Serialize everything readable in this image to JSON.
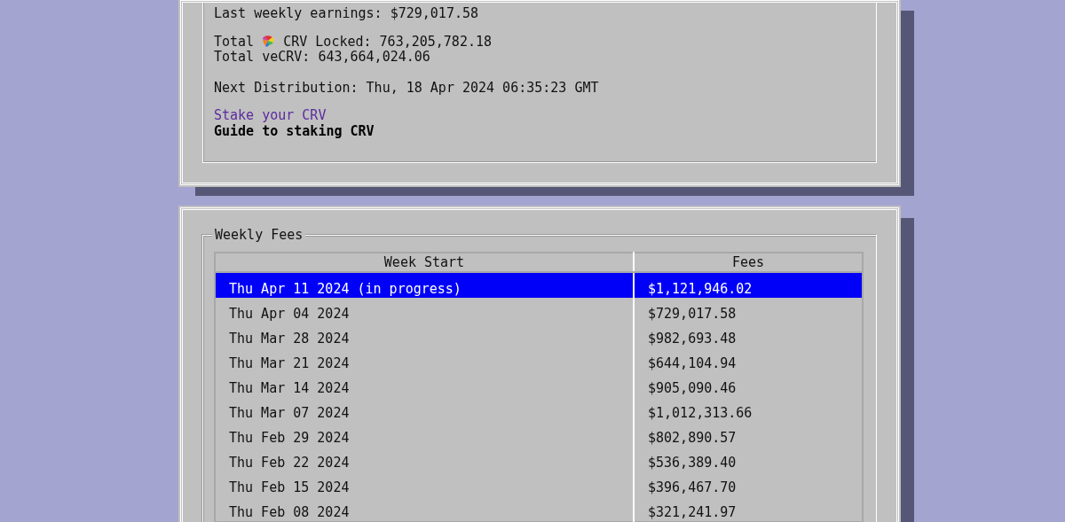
{
  "summary": {
    "lines_top": [
      "Last weekly earnings: $729,017.58"
    ],
    "crv_locked": {
      "before_icon": "Total",
      "after_icon": "CRV Locked: 763,205,782.18"
    },
    "lines_mid": [
      "Total veCRV: 643,664,024.06"
    ],
    "next_distribution": "Next Distribution: Thu, 18 Apr 2024 06:35:23 GMT",
    "links": [
      {
        "label": "Stake your CRV",
        "visited": true
      },
      {
        "label": "Guide to staking CRV",
        "visited": false
      }
    ]
  },
  "weekly_fees": {
    "title": "Weekly Fees",
    "columns": [
      "Week Start",
      "Fees"
    ],
    "rows": [
      {
        "week_start": "Thu Apr 11 2024 (in progress)",
        "fees": "$1,121,946.02",
        "selected": true
      },
      {
        "week_start": "Thu Apr 04 2024",
        "fees": "$729,017.58",
        "selected": false
      },
      {
        "week_start": "Thu Mar 28 2024",
        "fees": "$982,693.48",
        "selected": false
      },
      {
        "week_start": "Thu Mar 21 2024",
        "fees": "$644,104.94",
        "selected": false
      },
      {
        "week_start": "Thu Mar 14 2024",
        "fees": "$905,090.46",
        "selected": false
      },
      {
        "week_start": "Thu Mar 07 2024",
        "fees": "$1,012,313.66",
        "selected": false
      },
      {
        "week_start": "Thu Feb 29 2024",
        "fees": "$802,890.57",
        "selected": false
      },
      {
        "week_start": "Thu Feb 22 2024",
        "fees": "$536,389.40",
        "selected": false
      },
      {
        "week_start": "Thu Feb 15 2024",
        "fees": "$396,467.70",
        "selected": false
      },
      {
        "week_start": "Thu Feb 08 2024",
        "fees": "$321,241.97",
        "selected": false
      }
    ]
  }
}
